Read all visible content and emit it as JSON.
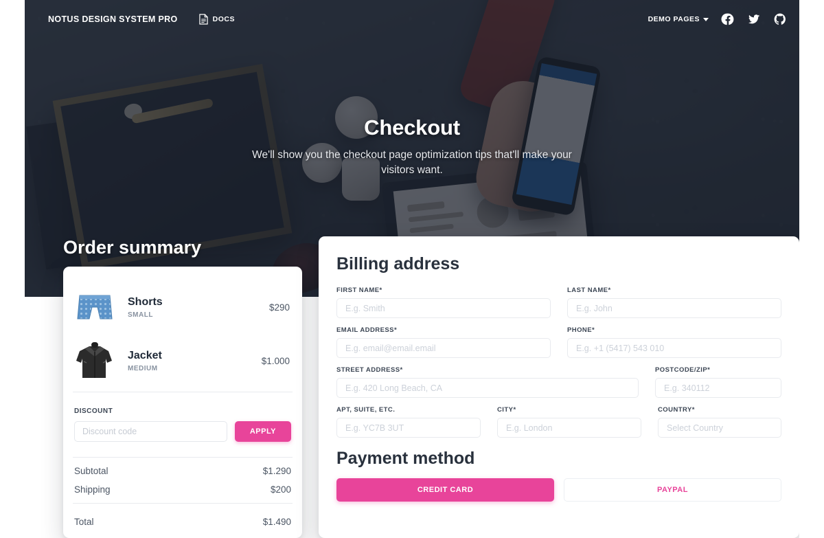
{
  "navbar": {
    "brand": "NOTUS DESIGN SYSTEM PRO",
    "docs_label": "DOCS",
    "docs_icon": "document-icon",
    "demo_pages_label": "DEMO PAGES",
    "caret_icon": "chevron-down-icon",
    "social": [
      {
        "name": "facebook-icon",
        "label": "Facebook"
      },
      {
        "name": "twitter-icon",
        "label": "Twitter"
      },
      {
        "name": "github-icon",
        "label": "GitHub"
      }
    ]
  },
  "hero": {
    "title": "Checkout",
    "subtitle": "We'll show you the checkout page optimization tips that'll make your visitors want."
  },
  "order_summary": {
    "heading": "Order summary",
    "products": [
      {
        "name": "Shorts",
        "size": "SMALL",
        "price": "$290",
        "thumb": "blue-shorts-thumbnail"
      },
      {
        "name": "Jacket",
        "size": "MEDIUM",
        "price": "$1.000",
        "thumb": "black-leather-jacket-thumbnail"
      }
    ],
    "discount": {
      "label": "DISCOUNT",
      "placeholder": "Discount code",
      "value": "",
      "apply_label": "APPLY"
    },
    "totals": [
      {
        "label": "Subtotal",
        "value": "$1.290"
      },
      {
        "label": "Shipping",
        "value": "$200"
      }
    ],
    "grand_total": {
      "label": "Total",
      "value": "$1.490"
    }
  },
  "billing": {
    "title": "Billing address",
    "fields": {
      "first_name": {
        "label": "FIRST NAME*",
        "placeholder": "E.g. Smith",
        "value": ""
      },
      "last_name": {
        "label": "LAST NAME*",
        "placeholder": "E.g. John",
        "value": ""
      },
      "email": {
        "label": "EMAIL ADDRESS*",
        "placeholder": "E.g. email@email.email",
        "value": ""
      },
      "phone": {
        "label": "PHONE*",
        "placeholder": "E.g. +1 (5417) 543 010",
        "value": ""
      },
      "street": {
        "label": "STREET ADDRESS*",
        "placeholder": "E.g. 420 Long Beach, CA",
        "value": ""
      },
      "postcode": {
        "label": "POSTCODE/ZIP*",
        "placeholder": "E.g. 340112",
        "value": ""
      },
      "apt": {
        "label": "APT, SUITE, ETC.",
        "placeholder": "E.g. YC7B 3UT",
        "value": ""
      },
      "city": {
        "label": "CITY*",
        "placeholder": "E.g. London",
        "value": ""
      },
      "country": {
        "label": "COUNTRY*",
        "placeholder": "Select Country",
        "value": ""
      }
    }
  },
  "payment": {
    "title": "Payment method",
    "tabs": [
      {
        "label": "CREDIT CARD",
        "active": true
      },
      {
        "label": "PAYPAL",
        "active": false
      }
    ]
  },
  "colors": {
    "accent_pink": "#e8449a",
    "dark_navy": "#1a202c",
    "heading": "#29313d",
    "muted_text": "#8892a0"
  }
}
